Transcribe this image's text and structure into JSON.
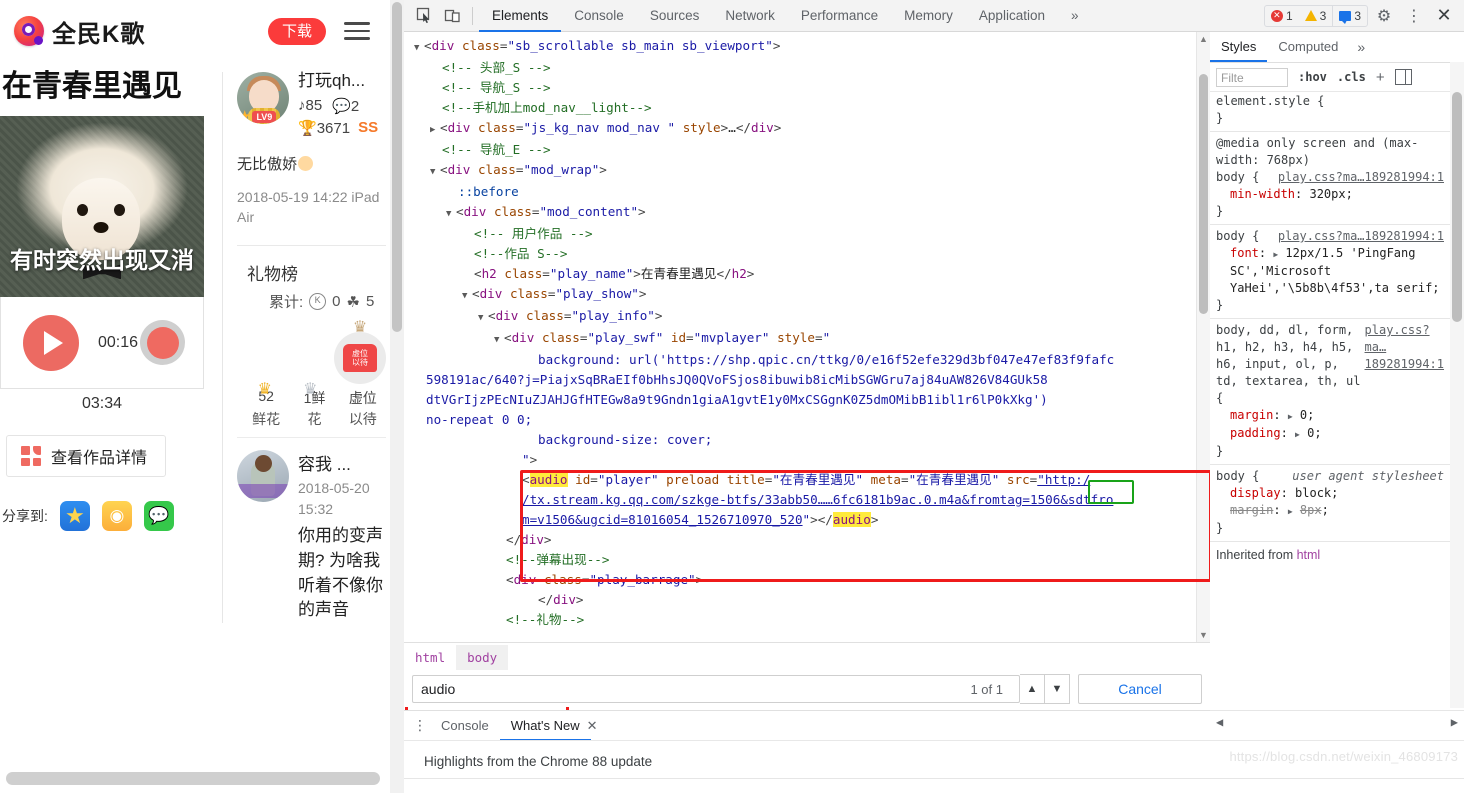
{
  "mobile": {
    "brand": "全民K歌",
    "download_label": "下载",
    "song_title": "在青春里遇见",
    "cover_subtitle": "有时突然出现又消",
    "player": {
      "current_time": "00:16",
      "total_time": "03:34"
    },
    "detail_button": "查看作品详情",
    "share_label": "分享到:",
    "share_targets": [
      "qzone-icon",
      "weibo-icon",
      "wechat-icon"
    ],
    "user": {
      "name": "打玩qh...",
      "level": "LV9",
      "listen_count": "85",
      "comment_count": "2",
      "flower_count": "3671",
      "rank_badge": "SS",
      "signature": "无比傲娇",
      "post_date": "2018-05-19 14:22 iPad Air"
    },
    "gift": {
      "title": "礼物榜",
      "total_label": "累计:",
      "k_count": "0",
      "flower_count": "5",
      "rows": [
        {
          "value": "52",
          "name": "鲜花"
        },
        {
          "value": "1鲜",
          "name": "花"
        },
        {
          "value": "虚位",
          "name": "以待"
        }
      ]
    },
    "comment": {
      "name": "容我 ...",
      "date": "2018-05-20 15:32",
      "text": "你用的变声期? 为啥我听着不像你的声音"
    }
  },
  "devtools": {
    "toolbar": {
      "inspect_icon": "inspect-cursor-icon",
      "device_icon": "device-toolbar-icon",
      "tabs": [
        "Elements",
        "Console",
        "Sources",
        "Network",
        "Performance",
        "Memory",
        "Application"
      ],
      "selected_tab": "Elements",
      "more_tabs": "»",
      "errors": "1",
      "warnings": "3",
      "messages": "3",
      "settings_icon": "gear-icon",
      "menu_icon": "kebab-menu-icon",
      "close_icon": "close-icon"
    },
    "dom_lines": [
      {
        "indent": 0,
        "arrow": "▼",
        "html": "<span class=\"punc\">&lt;</span><span class=\"tag\">div</span> <span class=\"attr\">class</span><span class=\"punc\">=</span><span class=\"val\">\"sb_scrollable sb_main sb_viewport\"</span><span class=\"punc\">&gt;</span>"
      },
      {
        "indent": 1,
        "arrow": "",
        "html": "<span class=\"cmt-g\">&lt;!-- 头部_S --&gt;</span>"
      },
      {
        "indent": 1,
        "arrow": "",
        "html": "<span class=\"cmt-g\">&lt;!-- 导航_S --&gt;</span>"
      },
      {
        "indent": 1,
        "arrow": "",
        "html": "<span class=\"cmt-g\">&lt;!--手机加上mod_nav__light--&gt;</span>"
      },
      {
        "indent": 1,
        "arrow": "▶",
        "html": "<span class=\"punc\">&lt;</span><span class=\"tag\">div</span> <span class=\"attr\">class</span><span class=\"punc\">=</span><span class=\"val\">\"js_kg_nav mod_nav \"</span> <span class=\"attr\">style</span><span class=\"punc\">&gt;</span><span class=\"txt\">…</span><span class=\"punc\">&lt;/</span><span class=\"tag\">div</span><span class=\"punc\">&gt;</span>"
      },
      {
        "indent": 1,
        "arrow": "",
        "html": "<span class=\"cmt-g\">&lt;!-- 导航_E --&gt;</span>"
      },
      {
        "indent": 1,
        "arrow": "▼",
        "html": "<span class=\"punc\">&lt;</span><span class=\"tag\">div</span> <span class=\"attr\">class</span><span class=\"punc\">=</span><span class=\"val\">\"mod_wrap\"</span><span class=\"punc\">&gt;</span>"
      },
      {
        "indent": 2,
        "arrow": "",
        "html": "<span class=\"pseudo\">::before</span>"
      },
      {
        "indent": 2,
        "arrow": "▼",
        "html": "<span class=\"punc\">&lt;</span><span class=\"tag\">div</span> <span class=\"attr\">class</span><span class=\"punc\">=</span><span class=\"val\">\"mod_content\"</span><span class=\"punc\">&gt;</span>"
      },
      {
        "indent": 3,
        "arrow": "",
        "html": "<span class=\"cmt-g\">&lt;!-- 用户作品 --&gt;</span>"
      },
      {
        "indent": 3,
        "arrow": "",
        "html": "<span class=\"cmt-g\">&lt;!--作品 S--&gt;</span>"
      },
      {
        "indent": 3,
        "arrow": "",
        "html": "<span class=\"punc\">&lt;</span><span class=\"tag\">h2</span> <span class=\"attr\">class</span><span class=\"punc\">=</span><span class=\"val\">\"play_name\"</span><span class=\"punc\">&gt;</span><span class=\"txt\">在青春里遇见</span><span class=\"punc\">&lt;/</span><span class=\"tag\">h2</span><span class=\"punc\">&gt;</span>"
      },
      {
        "indent": 3,
        "arrow": "▼",
        "html": "<span class=\"punc\">&lt;</span><span class=\"tag\">div</span> <span class=\"attr\">class</span><span class=\"punc\">=</span><span class=\"val\">\"play_show\"</span><span class=\"punc\">&gt;</span>"
      },
      {
        "indent": 4,
        "arrow": "▼",
        "html": "<span class=\"punc\">&lt;</span><span class=\"tag\">div</span> <span class=\"attr\">class</span><span class=\"punc\">=</span><span class=\"val\">\"play_info\"</span><span class=\"punc\">&gt;</span>"
      },
      {
        "indent": 5,
        "arrow": "▼",
        "html": "<span class=\"punc\">&lt;</span><span class=\"tag\">div</span> <span class=\"attr\">class</span><span class=\"punc\">=</span><span class=\"val\">\"play_swf\"</span> <span class=\"attr\">id</span><span class=\"punc\">=</span><span class=\"val\">\"mvplayer\"</span> <span class=\"attr\">style</span><span class=\"punc\">=</span><span class=\"val\">\"</span>"
      },
      {
        "indent": 7,
        "arrow": "",
        "html": "<span class=\"val\">background: url('https://shp.qpic.cn/ttkg/0/e16f52efe329d3bf047e47ef83f9fafc</span>"
      },
      {
        "indent": 0,
        "arrow": "",
        "html": "<span class=\"val\">598191ac/640?j=PiajxSqBRaEIf0bHhsJQ0QVoFSjos8ibuwib8icMibSGWGru7aj84uAW826V84GUk58</span>"
      },
      {
        "indent": 0,
        "arrow": "",
        "html": "<span class=\"val\">dtVGrIjzPEcNIuZJAHJGfHTEGw8a9t9Gndn1giaA1gvtE1y0MxCSGgnK0Z5dmOMibB1ibl1r6lP0kXkg')</span>"
      },
      {
        "indent": 0,
        "arrow": "",
        "html": "<span class=\"val\">no-repeat 0 0;</span>"
      },
      {
        "indent": 7,
        "arrow": "",
        "html": "<span class=\"val\">background-size: cover;</span>"
      },
      {
        "indent": 6,
        "arrow": "",
        "html": "<span class=\"val\">\"</span><span class=\"punc\">&gt;</span>"
      },
      {
        "indent": 6,
        "arrow": "",
        "html": "<span class=\"punc\">&lt;</span><span class=\"tag hl-yellow\">audio</span> <span class=\"attr\">id</span><span class=\"punc\">=</span><span class=\"val\">\"player\"</span> <span class=\"attr\">preload</span> <span class=\"attr\">title</span><span class=\"punc\">=</span><span class=\"val\">\"在青春里遇见\"</span> <span class=\"attr\">meta</span><span class=\"punc\">=</span><span class=\"val\">\"在青春里遇见\"</span> <span class=\"attr\">src</span><span class=\"punc\">=</span><span class=\"lnk\">\"http:/</span>"
      },
      {
        "indent": 6,
        "arrow": "",
        "html": "<span class=\"lnk\">/tx.stream.kg.qq.com/szkge-btfs/33abb50……6fc6181b9ac.0.m4a&amp;fromtag=1506&amp;sdtfro</span>"
      },
      {
        "indent": 6,
        "arrow": "",
        "html": "<span class=\"lnk\">m=v1506&amp;ugcid=81016054_1526710970_520</span><span class=\"val\">\"</span><span class=\"punc\">&gt;&lt;/</span><span class=\"tag hl-yellow\">audio</span><span class=\"punc\">&gt;</span>"
      },
      {
        "indent": 5,
        "arrow": "",
        "html": "<span class=\"punc\">&lt;/</span><span class=\"tag\">div</span><span class=\"punc\">&gt;</span>"
      },
      {
        "indent": 5,
        "arrow": "",
        "html": "<span class=\"cmt-g\">&lt;!--弹幕出现--&gt;</span>"
      },
      {
        "indent": 5,
        "arrow": "",
        "html": "<span class=\"punc\">&lt;</span><span class=\"tag\">div</span> <span class=\"attr\">class</span><span class=\"punc\">=</span><span class=\"val\">\"play_barrage\"</span><span class=\"punc\">&gt;</span>"
      },
      {
        "indent": 7,
        "arrow": "",
        "html": "<span class=\"punc\">&lt;/</span><span class=\"tag\">div</span><span class=\"punc\">&gt;</span>"
      },
      {
        "indent": 5,
        "arrow": "",
        "html": "<span class=\"cmt-g\">&lt;!--礼物--&gt;</span>"
      }
    ],
    "breadcrumb": [
      "html",
      "body"
    ],
    "breadcrumb_selected": "body",
    "find": {
      "value": "audio",
      "count": "1 of 1",
      "up_icon": "chevron-up-icon",
      "down_icon": "chevron-down-icon",
      "cancel_label": "Cancel"
    },
    "drawer": {
      "menu_icon": "kebab-menu-icon",
      "tabs": [
        "Console",
        "What's New"
      ],
      "selected_tab": "What's New",
      "close_icon": "close-icon",
      "content": "Highlights from the Chrome 88 update"
    },
    "watermark": "https://blog.csdn.net/weixin_46809173",
    "styles": {
      "tabs": [
        "Styles",
        "Computed"
      ],
      "selected_tab": "Styles",
      "more_icon": "»",
      "filter_placeholder": "Filte",
      "hov_label": ":hov",
      "cls_label": ".cls",
      "plus_label": "+",
      "sidebar_icon": "toggle-sidebar-icon",
      "rules": [
        {
          "type": "element",
          "selector": "element.style",
          "source": "",
          "decls": []
        },
        {
          "type": "media",
          "media": "@media only screen and (max-width: 768px)",
          "selector": "body",
          "source": "play.css?ma…189281994:1",
          "decls": [
            {
              "prop": "min-width",
              "value": "320px",
              "expand": false
            }
          ]
        },
        {
          "type": "normal",
          "selector": "body",
          "source": "play.css?ma…189281994:1",
          "decls": [
            {
              "prop": "font",
              "value": "12px/1.5 'PingFang SC','Microsoft YaHei','\\5b8b\\4f53',ta serif;",
              "expand": true
            }
          ]
        },
        {
          "type": "normal",
          "selector": "body, dd, dl, form, h1, h2, h3, h4, h5, h6, input, ol, p, td, textarea, th, ul",
          "source": "play.css?ma…189281994:1",
          "decls": [
            {
              "prop": "margin",
              "value": "0",
              "expand": true
            },
            {
              "prop": "padding",
              "value": "0",
              "expand": true
            }
          ]
        },
        {
          "type": "ua",
          "selector": "body",
          "source": "user agent stylesheet",
          "decls": [
            {
              "prop": "display",
              "value": "block",
              "expand": false
            },
            {
              "prop": "margin",
              "value": "8px",
              "expand": true,
              "strike": true
            }
          ]
        }
      ],
      "inherited_label": "Inherited from",
      "inherited_from": "html"
    }
  }
}
